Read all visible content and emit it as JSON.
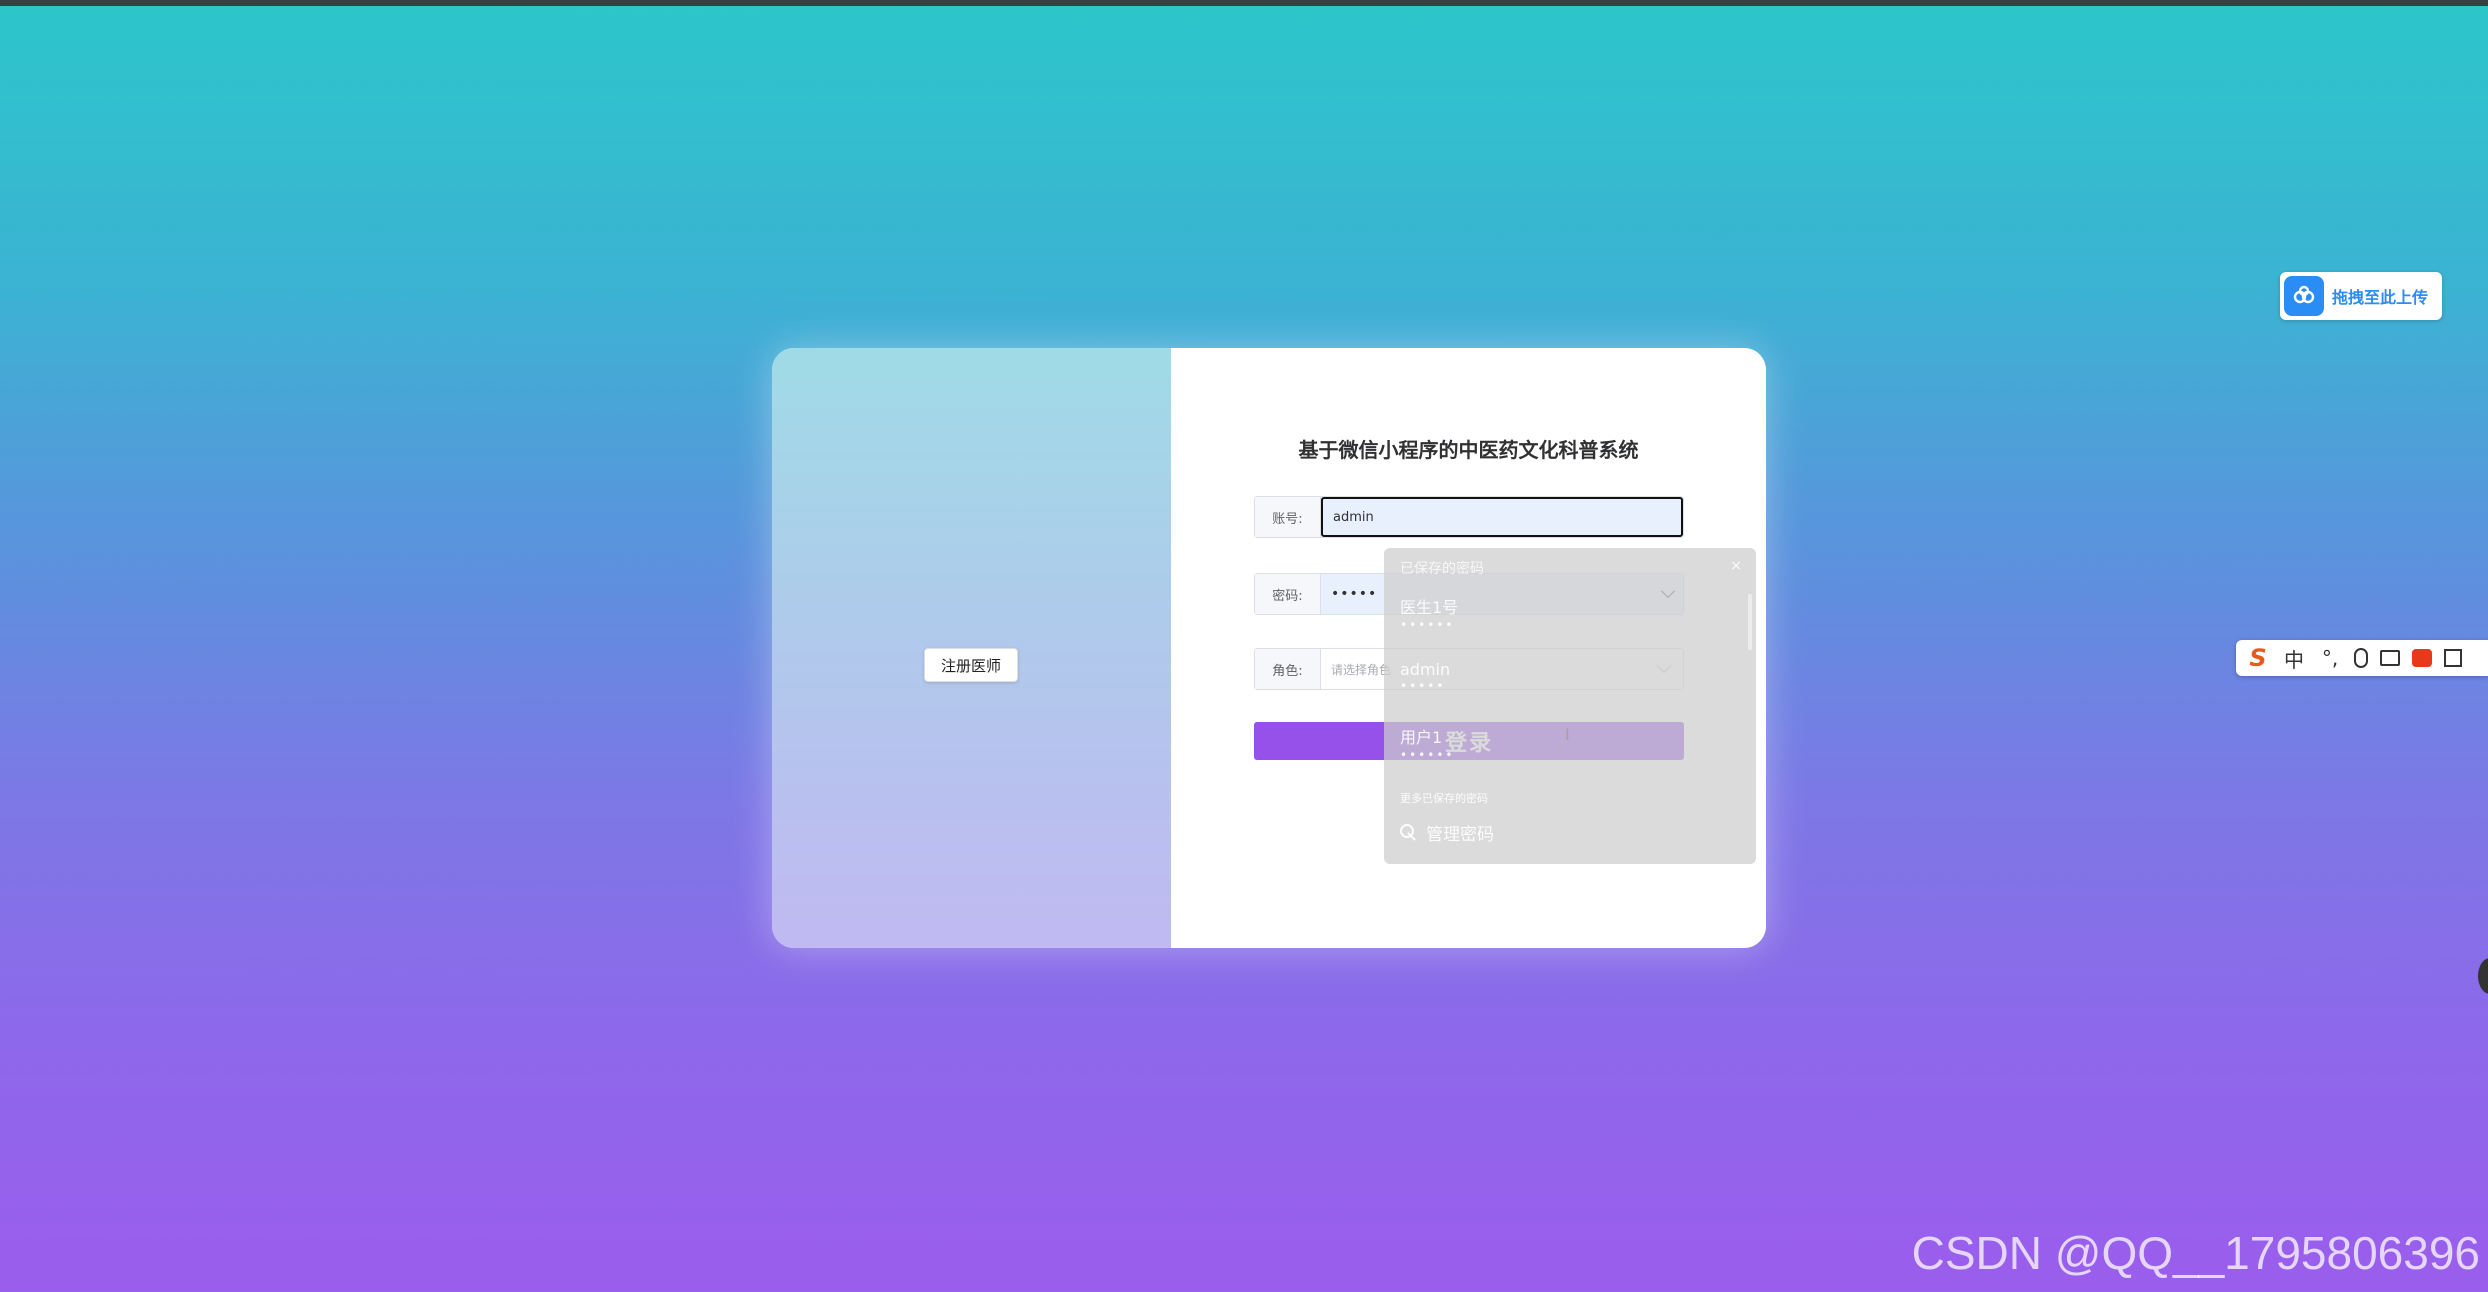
{
  "card": {
    "register_button": "注册医师",
    "title": "基于微信小程序的中医药文化科普系统",
    "account": {
      "label": "账号:",
      "value": "admin"
    },
    "password": {
      "label": "密码:",
      "value": "•••••"
    },
    "role": {
      "label": "角色:",
      "placeholder": "请选择角色"
    },
    "login_button": "登录"
  },
  "autofill": {
    "header": "已保存的密码",
    "entries": [
      {
        "user": "医生1号",
        "password": "••••••"
      },
      {
        "user": "admin",
        "password": "•••••"
      },
      {
        "user": "用户1",
        "password": "••••••"
      }
    ],
    "more": "更多已保存的密码",
    "manage": "管理密码"
  },
  "baidu": {
    "label": "拖拽至此上传"
  },
  "ime": {
    "lang": "中",
    "punct": "°,"
  },
  "watermark": "CSDN @QQ__1795806396"
}
